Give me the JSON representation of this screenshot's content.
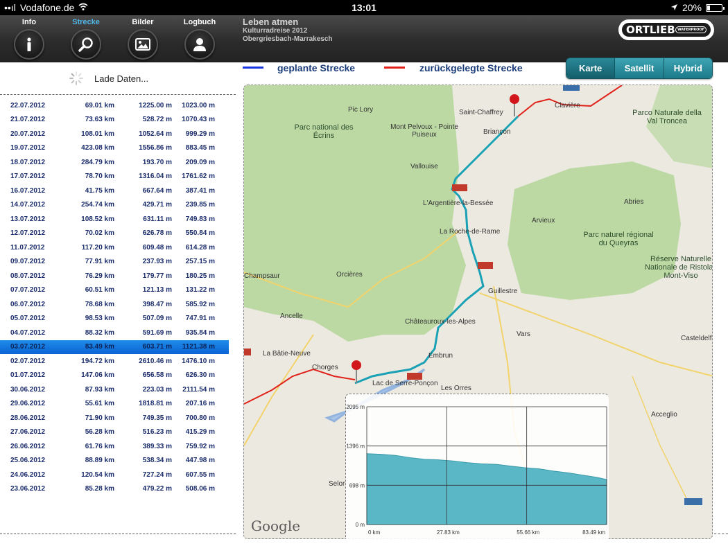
{
  "status": {
    "carrier": "Vodafone.de",
    "time": "13:01",
    "battery": "20%",
    "battery_level": 0.2
  },
  "tabs": [
    {
      "label": "Info",
      "icon": "info-icon",
      "active": false
    },
    {
      "label": "Strecke",
      "icon": "search-icon",
      "active": true
    },
    {
      "label": "Bilder",
      "icon": "picture-icon",
      "active": false
    },
    {
      "label": "Logbuch",
      "icon": "person-icon",
      "active": false
    }
  ],
  "trip": {
    "title": "Leben atmen",
    "subtitle": "Kulturradreise 2012",
    "route": "Obergriesbach-Marrakesch"
  },
  "logo": {
    "brand": "ORTLIEB",
    "tag": "WATERPROOF"
  },
  "loading_text": "Lade Daten...",
  "legend": {
    "planned": "geplante Strecke",
    "travelled": "zurückgelegte Strecke",
    "planned_color": "#1a34e0",
    "travelled_color": "#e0231a"
  },
  "map_modes": [
    "Karte",
    "Satellit",
    "Hybrid"
  ],
  "map_mode_selected": "Karte",
  "log": [
    [
      "22.07.2012",
      "69.01 km",
      "1225.00 m",
      "1023.00 m"
    ],
    [
      "21.07.2012",
      "73.63 km",
      "528.72 m",
      "1070.43 m"
    ],
    [
      "20.07.2012",
      "108.01 km",
      "1052.64 m",
      "999.29 m"
    ],
    [
      "19.07.2012",
      "423.08 km",
      "1556.86 m",
      "883.45 m"
    ],
    [
      "18.07.2012",
      "284.79 km",
      "193.70 m",
      "209.09 m"
    ],
    [
      "17.07.2012",
      "78.70 km",
      "1316.04 m",
      "1761.62 m"
    ],
    [
      "16.07.2012",
      "41.75 km",
      "667.64 m",
      "387.41 m"
    ],
    [
      "14.07.2012",
      "254.74 km",
      "429.71 m",
      "239.85 m"
    ],
    [
      "13.07.2012",
      "108.52 km",
      "631.11 m",
      "749.83 m"
    ],
    [
      "12.07.2012",
      "70.02 km",
      "626.78 m",
      "550.84 m"
    ],
    [
      "11.07.2012",
      "117.20 km",
      "609.48 m",
      "614.28 m"
    ],
    [
      "09.07.2012",
      "77.91 km",
      "237.93 m",
      "257.15 m"
    ],
    [
      "08.07.2012",
      "76.29 km",
      "179.77 m",
      "180.25 m"
    ],
    [
      "07.07.2012",
      "60.51 km",
      "121.13 m",
      "131.22 m"
    ],
    [
      "06.07.2012",
      "78.68 km",
      "398.47 m",
      "585.92 m"
    ],
    [
      "05.07.2012",
      "98.53 km",
      "507.09 m",
      "747.91 m"
    ],
    [
      "04.07.2012",
      "88.32 km",
      "591.69 m",
      "935.84 m"
    ],
    [
      "03.07.2012",
      "83.49 km",
      "603.71 m",
      "1121.38 m"
    ],
    [
      "02.07.2012",
      "194.72 km",
      "2610.46 m",
      "1476.10 m"
    ],
    [
      "01.07.2012",
      "147.06 km",
      "656.58 m",
      "626.30 m"
    ],
    [
      "30.06.2012",
      "87.93 km",
      "223.03 m",
      "2111.54 m"
    ],
    [
      "29.06.2012",
      "55.61 km",
      "1818.81 m",
      "207.16 m"
    ],
    [
      "28.06.2012",
      "71.90 km",
      "749.35 m",
      "700.80 m"
    ],
    [
      "27.06.2012",
      "56.28 km",
      "516.23 m",
      "415.29 m"
    ],
    [
      "26.06.2012",
      "61.76 km",
      "389.33 m",
      "759.92 m"
    ],
    [
      "25.06.2012",
      "88.89 km",
      "538.34 m",
      "447.98 m"
    ],
    [
      "24.06.2012",
      "120.54 km",
      "727.24 m",
      "607.55 m"
    ],
    [
      "23.06.2012",
      "85.28 km",
      "479.22 m",
      "508.06 m"
    ]
  ],
  "selected_date": "03.07.2012",
  "map": {
    "attribution": "Google",
    "places": [
      "Pic Lory",
      "Parc national des Écrins",
      "Mont Pelvoux - Pointe Puiseux",
      "Saint-Chaffrey",
      "Briançon",
      "Clavière",
      "Parco Naturale della Val Troncea",
      "Vallouise",
      "L'Argentière-la-Bessée",
      "La Roche-de-Rame",
      "Arvieux",
      "Abries",
      "Parc naturel régional du Queyras",
      "Réserve Naturelle Nationale de Ristolas Mont-Viso",
      "Champsaur",
      "Orcières",
      "Guillestre",
      "Ancelle",
      "Châteauroux-les-Alpes",
      "Vars",
      "Embrun",
      "La Bâtie-Neuve",
      "Chorges",
      "Les Orres",
      "Casteldelfino",
      "Acceglio",
      "Selon",
      "Lac de Serre-Ponçon"
    ],
    "road_labels": [
      "N94",
      "N94",
      "N94",
      "SS24",
      "SS21"
    ]
  },
  "chart_data": {
    "type": "area",
    "title": "",
    "xlabel": "",
    "ylabel": "",
    "x_ticks": [
      "0 km",
      "27.83 km",
      "55.66 km",
      "83.49 km"
    ],
    "y_ticks": [
      "0 m",
      "698 m",
      "1396 m",
      "2095 m"
    ],
    "xlim": [
      0,
      83.49
    ],
    "ylim": [
      0,
      2095
    ],
    "series": [
      {
        "x": [
          0,
          5,
          10,
          15,
          20,
          25,
          30,
          35,
          40,
          45,
          50,
          55,
          60,
          65,
          70,
          75,
          80,
          83.49
        ],
        "y": [
          1260,
          1250,
          1230,
          1190,
          1160,
          1150,
          1130,
          1100,
          1080,
          1070,
          1040,
          1010,
          990,
          950,
          920,
          880,
          840,
          800
        ]
      }
    ],
    "grid": true,
    "color": "#5ab7c6"
  }
}
